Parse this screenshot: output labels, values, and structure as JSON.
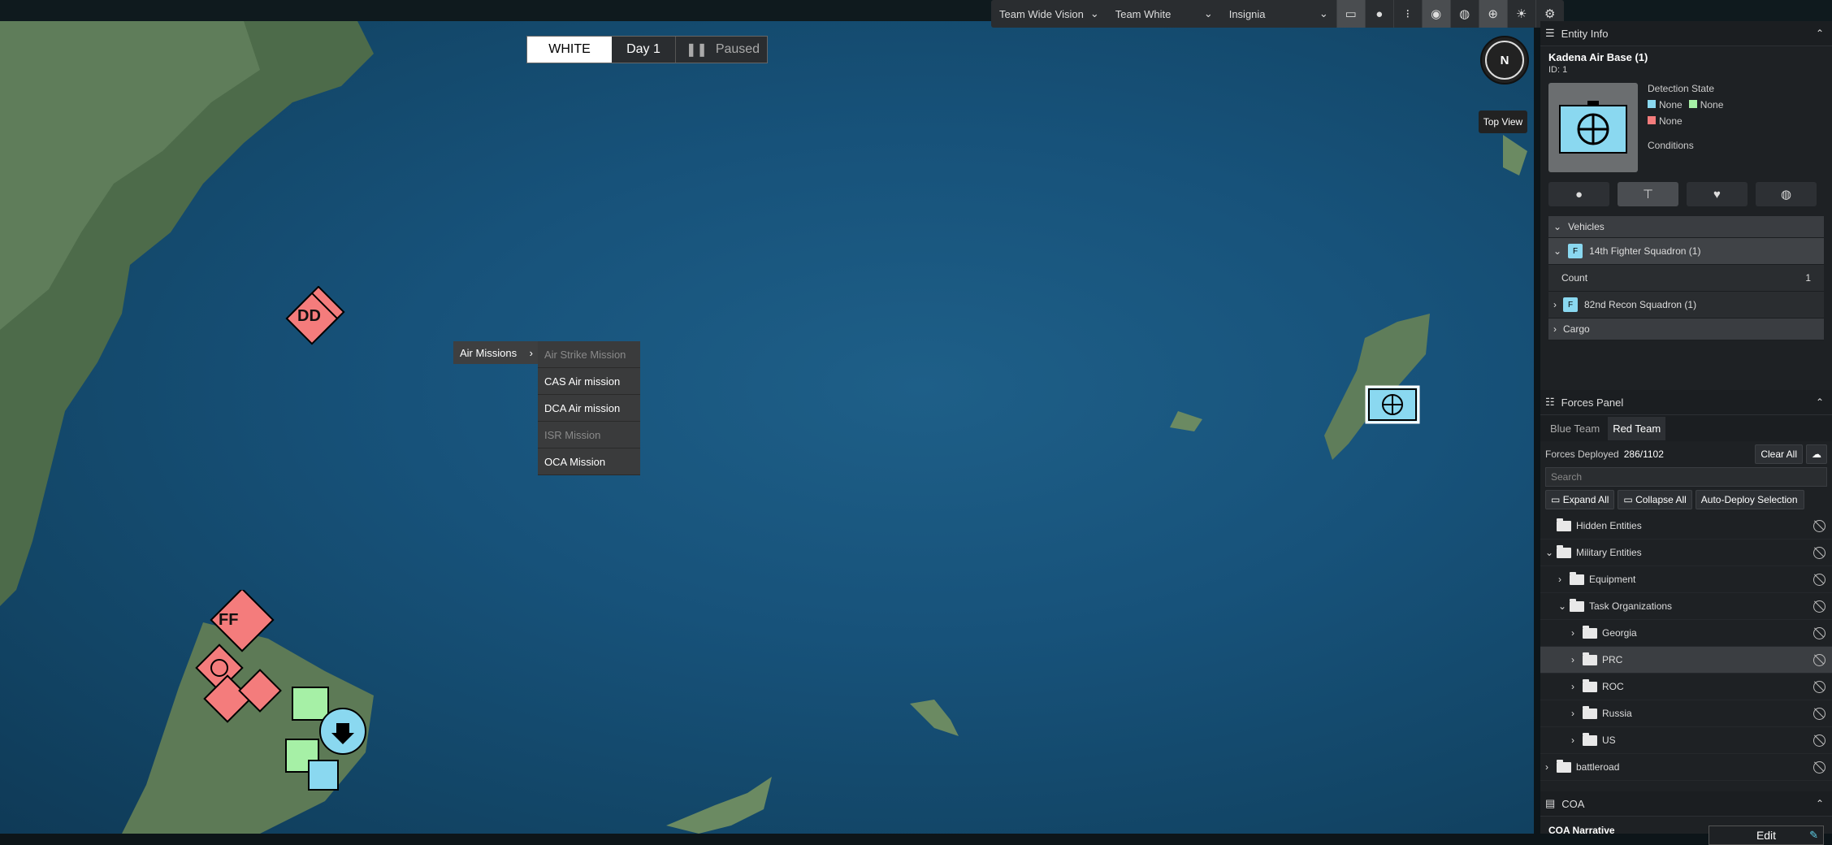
{
  "toolbar": {
    "vision_select": "Team Wide Vision",
    "team_select": "Team White",
    "display_select": "Insignia"
  },
  "time": {
    "team": "WHITE",
    "day": "Day 1",
    "state": "Paused"
  },
  "map": {
    "compass": "N",
    "top_view": "Top View",
    "unit_labels": [
      "DD",
      "FF"
    ]
  },
  "context_menu": {
    "parent": "Air Missions",
    "items": [
      {
        "label": "Air Strike Mission",
        "disabled": true
      },
      {
        "label": "CAS Air mission",
        "disabled": false
      },
      {
        "label": "DCA Air mission",
        "disabled": false
      },
      {
        "label": "ISR Mission",
        "disabled": true
      },
      {
        "label": "OCA Mission",
        "disabled": false
      }
    ]
  },
  "entity_info": {
    "header": "Entity Info",
    "name": "Kadena Air Base",
    "count": "(1)",
    "id": "ID: 1",
    "detection_label": "Detection State",
    "detection": [
      "None",
      "None",
      "None"
    ],
    "conditions_label": "Conditions",
    "vehicles_header": "Vehicles",
    "vehicles": [
      {
        "name": "14th Fighter Squadron (1)",
        "expanded": true
      },
      {
        "name": "82nd Recon Squadron (1)",
        "expanded": false
      }
    ],
    "count_label": "Count",
    "count_value": "1",
    "cargo_label": "Cargo"
  },
  "forces_panel": {
    "header": "Forces Panel",
    "tabs": [
      "Blue Team",
      "Red Team"
    ],
    "active_tab": "Red Team",
    "deployed_label": "Forces Deployed",
    "deployed_value": "286/1102",
    "clear_all": "Clear All",
    "search_placeholder": "Search",
    "expand_all": "Expand All",
    "collapse_all": "Collapse All",
    "auto_deploy": "Auto-Deploy Selection",
    "tree": [
      {
        "label": "Hidden Entities",
        "depth": 0
      },
      {
        "label": "Military Entities",
        "depth": 0
      },
      {
        "label": "Equipment",
        "depth": 1
      },
      {
        "label": "Task Organizations",
        "depth": 1
      },
      {
        "label": "Georgia",
        "depth": 2
      },
      {
        "label": "PRC",
        "depth": 2
      },
      {
        "label": "ROC",
        "depth": 2
      },
      {
        "label": "Russia",
        "depth": 2
      },
      {
        "label": "US",
        "depth": 2
      },
      {
        "label": "battleroad",
        "depth": 0
      }
    ]
  },
  "coa": {
    "header": "COA",
    "narrative_label": "COA Narrative",
    "edit": "Edit"
  },
  "colors": {
    "friendly": "#8ad8f0",
    "hostile": "#f47c7c",
    "neutral": "#a6f0a6",
    "panel": "#1e2124"
  }
}
